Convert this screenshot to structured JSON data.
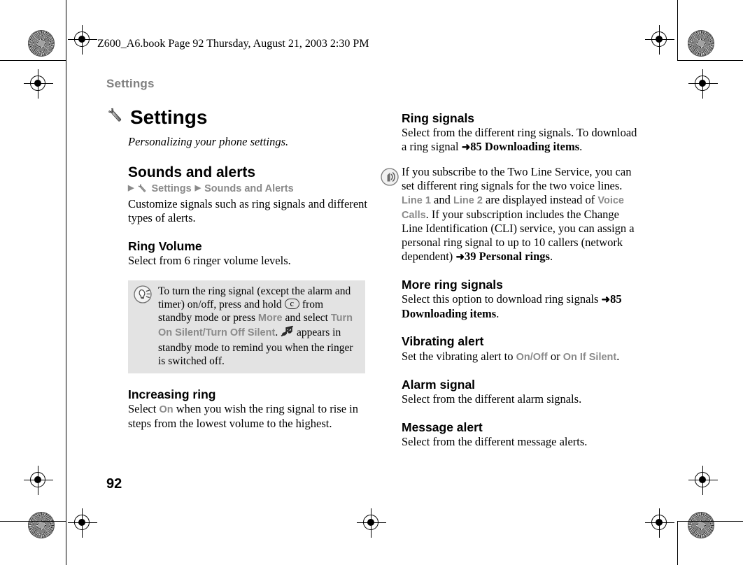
{
  "printer_marks": {
    "present": true
  },
  "header": {
    "file_line": "Z600_A6.book  Page 92  Thursday, August 21, 2003  2:30 PM",
    "running_head": "Settings",
    "page_number": "92"
  },
  "chapter": {
    "icon": "wrench-icon",
    "title": "Settings",
    "subtitle": "Personalizing your phone settings."
  },
  "left_column": {
    "section": {
      "heading": "Sounds and alerts",
      "breadcrumb": {
        "lead_arrow": "▶",
        "icon": "wrench-icon",
        "item1": "Settings",
        "sep_arrow": "▶",
        "item2": "Sounds and Alerts"
      },
      "body": "Customize signals such as ring signals and different types of alerts."
    },
    "ring_volume": {
      "heading": "Ring Volume",
      "body": "Select from 6 ringer volume levels."
    },
    "tip": {
      "icon": "tip-bulb-icon",
      "text_1": "To turn the ring signal (except the alarm and timer) on/off, press and hold ",
      "key": "c",
      "text_2": " from standby mode or press ",
      "ui_1": "More",
      "text_3": " and select ",
      "ui_2": "Turn On Silent",
      "slash": "/",
      "ui_3": "Turn Off Silent",
      "text_4": ". ",
      "inline_icon": "silent-mode-icon",
      "text_5": " appears in standby mode to remind you when the ringer is switched off."
    },
    "increasing_ring": {
      "heading": "Increasing ring",
      "text_1": "Select ",
      "ui_1": "On",
      "text_2": " when you wish the ring signal to rise in steps from the lowest volume to the highest."
    }
  },
  "right_column": {
    "ring_signals": {
      "heading": "Ring signals",
      "text_1": "Select from the different ring signals. To download a ring signal ",
      "arrow": "➜",
      "xref": "85 Downloading items",
      "text_2": "."
    },
    "note": {
      "icon": "ring-signal-icon",
      "text_1": "If you subscribe to the Two Line Service, you can set different ring signals for the two voice lines. ",
      "ui_1": "Line 1",
      "text_2": " and ",
      "ui_2": "Line 2",
      "text_3": " are displayed instead of ",
      "ui_3": "Voice Calls",
      "text_4": ". If your subscription includes the Change Line Identification (CLI) service, you can assign a personal ring signal to up to 10 callers (network dependent) ",
      "arrow": "➜",
      "xref": "39 Personal rings",
      "text_5": "."
    },
    "more_ring_signals": {
      "heading": "More ring signals",
      "text_1": "Select this option to download ring signals ",
      "arrow": "➜",
      "xref": "85 Downloading items",
      "text_2": "."
    },
    "vibrating_alert": {
      "heading": "Vibrating alert",
      "text_1": "Set the vibrating alert to ",
      "ui_1": "On",
      "slash": "/",
      "ui_2": "Off",
      "text_2": " or ",
      "ui_3": "On If Silent",
      "text_3": "."
    },
    "alarm_signal": {
      "heading": "Alarm signal",
      "body": "Select from the different alarm signals."
    },
    "message_alert": {
      "heading": "Message alert",
      "body": "Select from the different message alerts."
    }
  }
}
